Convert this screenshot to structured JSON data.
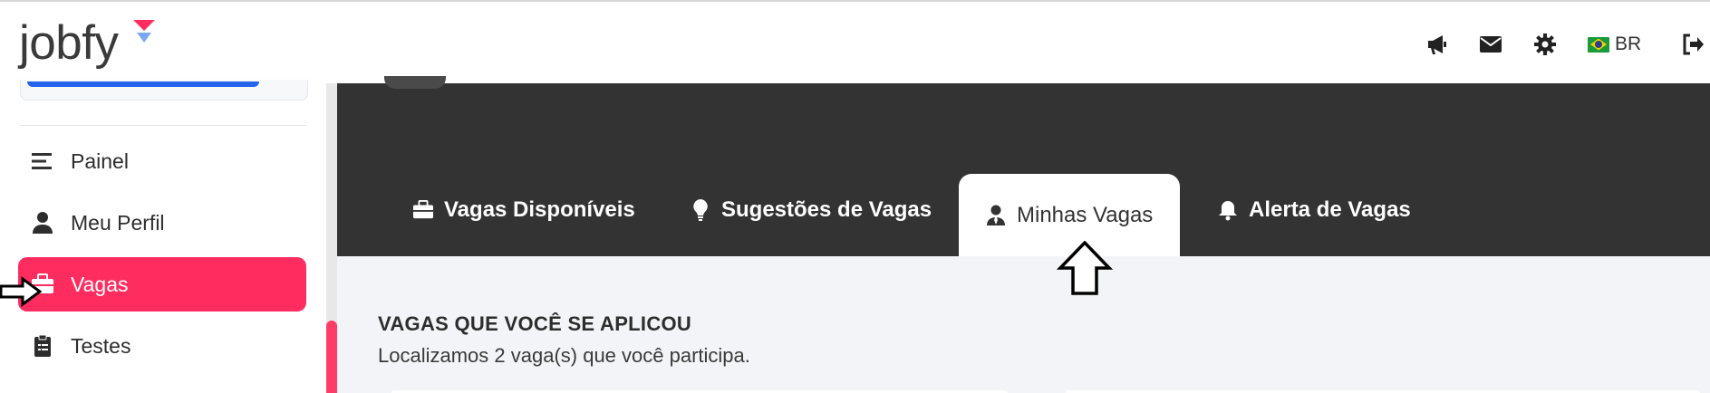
{
  "brand": {
    "name": "jobfy"
  },
  "header": {
    "icons": [
      "megaphone-icon",
      "envelope-icon",
      "gear-icon",
      "logout-icon"
    ],
    "language": "BR"
  },
  "sidebar": {
    "items": [
      {
        "label": "Painel",
        "icon": "menu-icon"
      },
      {
        "label": "Meu Perfil",
        "icon": "user-icon"
      },
      {
        "label": "Vagas",
        "icon": "briefcase-icon",
        "active": true
      },
      {
        "label": "Testes",
        "icon": "clipboard-icon"
      }
    ]
  },
  "tabs": [
    {
      "label": "Vagas Disponíveis",
      "icon": "briefcase-icon"
    },
    {
      "label": "Sugestões de Vagas",
      "icon": "lightbulb-icon"
    },
    {
      "label": "Minhas Vagas",
      "icon": "user-tie-icon",
      "active": true
    },
    {
      "label": "Alerta de Vagas",
      "icon": "bell-icon"
    }
  ],
  "main": {
    "title": "VAGAS QUE VOCÊ SE APLICOU",
    "subtitle": "Localizamos 2 vaga(s) que você participa."
  },
  "colors": {
    "accent": "#ff2d5f",
    "dark_band": "#333333",
    "content_bg": "#f3f4f7"
  }
}
